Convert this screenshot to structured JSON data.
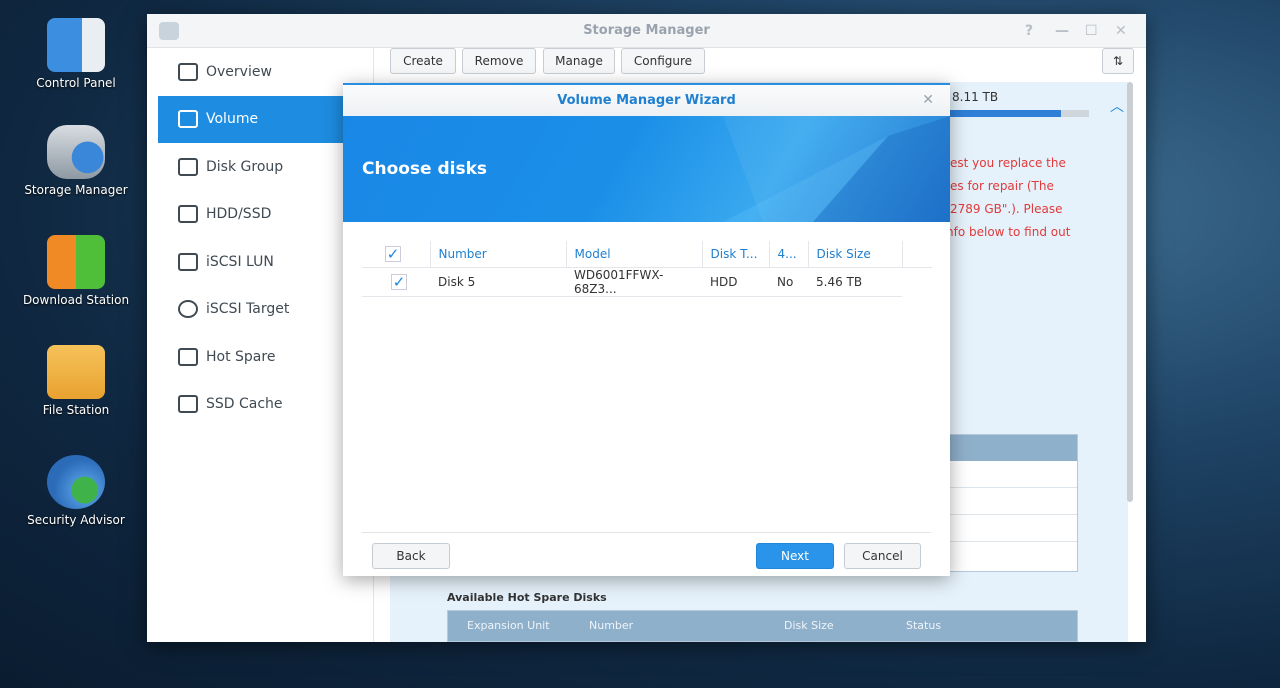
{
  "desktop": {
    "icons": [
      {
        "label": "Control Panel"
      },
      {
        "label": "Storage Manager"
      },
      {
        "label": "Download Station"
      },
      {
        "label": "File Station"
      },
      {
        "label": "Security Advisor"
      }
    ]
  },
  "window": {
    "title": "Storage Manager",
    "controls": [
      "?",
      "—",
      "☐",
      "✕"
    ]
  },
  "sidebar": {
    "items": [
      {
        "label": "Overview"
      },
      {
        "label": "Volume",
        "active": true
      },
      {
        "label": "Disk Group"
      },
      {
        "label": "HDD/SSD"
      },
      {
        "label": "iSCSI LUN"
      },
      {
        "label": "iSCSI Target"
      },
      {
        "label": "Hot Spare"
      },
      {
        "label": "SSD Cache"
      }
    ]
  },
  "toolbar": {
    "create": "Create",
    "remove": "Remove",
    "manage": "Manage",
    "configure": "Configure",
    "sort_icon": "⇅"
  },
  "background": {
    "capacity": "8.11 TB",
    "capacity_fraction": 0.8,
    "warning_lines": [
      "est you replace the",
      "es for repair (The",
      "2789 GB\".). Please",
      "nfo below to find out"
    ],
    "hot_spare_title": "Available Hot Spare Disks",
    "hot_spare_columns": [
      "Expansion Unit",
      "Number",
      "Disk Size",
      "Status"
    ]
  },
  "dialog": {
    "title": "Volume Manager Wizard",
    "heading": "Choose disks",
    "columns": [
      "Number",
      "Model",
      "Disk T...",
      "4...",
      "Disk Size"
    ],
    "rows": [
      {
        "checked": true,
        "number": "Disk 5",
        "model": "WD6001FFWX-68Z3...",
        "type": "HDD",
        "col4": "No",
        "size": "5.46 TB"
      }
    ],
    "back": "Back",
    "next": "Next",
    "cancel": "Cancel",
    "close": "✕"
  },
  "colors": {
    "accent": "#1e8ce0",
    "warning": "#e03a3a"
  }
}
